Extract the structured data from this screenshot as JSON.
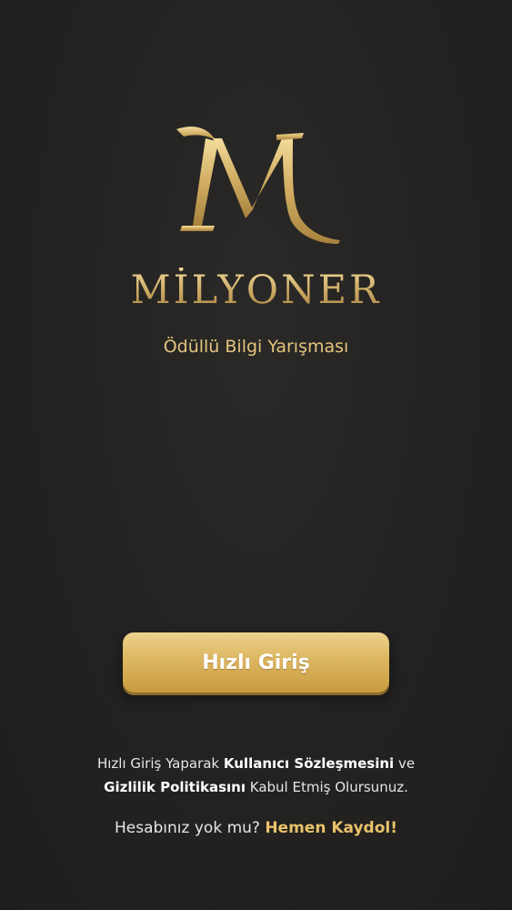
{
  "brand": {
    "logo_icon": "m-monogram-logo",
    "name": "MİLYONER",
    "tagline": "Ödüllü Bilgi Yarışması"
  },
  "actions": {
    "quick_login_label": "Hızlı Giriş"
  },
  "terms": {
    "prefix": "Hızlı Giriş Yaparak ",
    "user_agreement": "Kullanıcı Sözleşmesini",
    "conjunction": " ve",
    "privacy_policy": "Gizlilik Politikasını",
    "suffix": " Kabul Etmiş Olursunuz."
  },
  "signup": {
    "question": "Hesabınız yok mu? ",
    "link": "Hemen Kaydol!"
  },
  "colors": {
    "background": "#222120",
    "gold": "#d8b365",
    "gold_light": "#ecd28c",
    "text": "#e6e6e6"
  }
}
